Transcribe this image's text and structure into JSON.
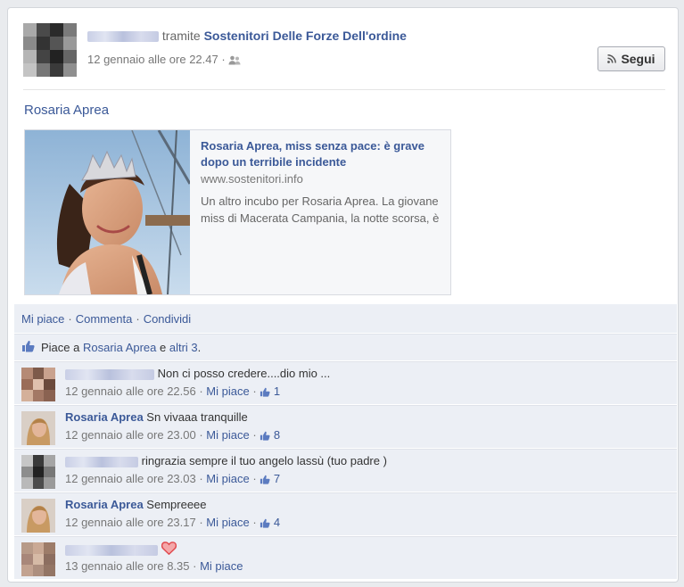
{
  "post": {
    "via": "tramite",
    "page_name": "Sostenitori Delle Forze Dell'ordine",
    "timestamp": "12 gennaio alle ore 22.47",
    "meta_sep": "·",
    "follow_label": "Segui",
    "title": "Rosaria Aprea"
  },
  "share": {
    "title": "Rosaria Aprea, miss senza pace: è grave dopo un terribile incidente",
    "domain": "www.sostenitori.info",
    "description": "Un altro incubo per Rosaria Aprea. La giovane miss di Macerata Campania, la notte scorsa, è"
  },
  "actions": {
    "like": "Mi piace",
    "comment": "Commenta",
    "share": "Condividi",
    "sep": "·"
  },
  "likes": {
    "prefix": "Piace a",
    "name": "Rosaria Aprea",
    "conj": "e",
    "others": "altri 3",
    "suffix": "."
  },
  "comments": [
    {
      "author": "",
      "text": "Non ci posso credere....dio mio ...",
      "time": "12 gennaio alle ore 22.56",
      "like_label": "Mi piace",
      "likes": "1"
    },
    {
      "author": "Rosaria Aprea",
      "text": "Sn vivaaa tranquille",
      "time": "12 gennaio alle ore 23.00",
      "like_label": "Mi piace",
      "likes": "8"
    },
    {
      "author": "",
      "text": "ringrazia sempre il tuo angelo lassù (tuo padre )",
      "time": "12 gennaio alle ore 23.03",
      "like_label": "Mi piace",
      "likes": "7"
    },
    {
      "author": "Rosaria Aprea",
      "text": "Sempreeee",
      "time": "12 gennaio alle ore 23.17",
      "like_label": "Mi piace",
      "likes": "4"
    },
    {
      "author": "",
      "text": "",
      "time": "13 gennaio alle ore 8.35",
      "like_label": "Mi piace",
      "likes": ""
    }
  ],
  "colors": {
    "link": "#3b5998",
    "panel": "#eceff5",
    "heart": "#e0474c"
  }
}
